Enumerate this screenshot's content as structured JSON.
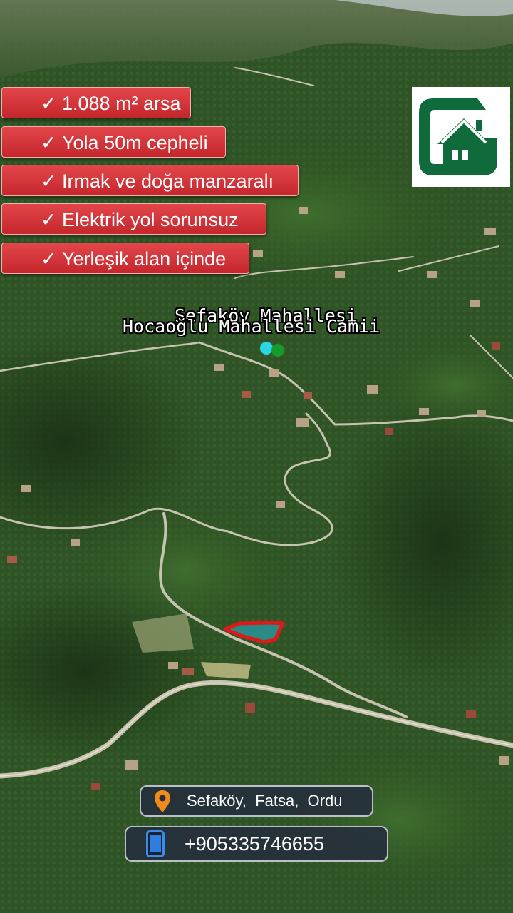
{
  "features": [
    {
      "label": "1.088 m² arsa"
    },
    {
      "label": "Yola 50m cepheli"
    },
    {
      "label": "Irmak ve doğa manzaralı"
    },
    {
      "label": "Elektrik yol sorunsuz"
    },
    {
      "label": "Yerleşik alan içinde"
    }
  ],
  "check_glyph": "✓",
  "map_labels": {
    "neighborhood": "Sefaköy Mahallesi",
    "mosque": "Hocaoğlu Mahallesi Camii"
  },
  "location": {
    "icon": "location-pin-icon",
    "text": "Sefaköy,  Fatsa,  Ordu"
  },
  "phone": {
    "icon": "smartphone-icon",
    "number": "+905335746655"
  },
  "logo": {
    "icon": "house-logo-icon",
    "color": "#0f6b3c"
  },
  "colors": {
    "badge": "#d6353a",
    "parcel_outline": "#e01818",
    "parcel_fill": "#2a8a86",
    "pin": "#f08a1c"
  }
}
